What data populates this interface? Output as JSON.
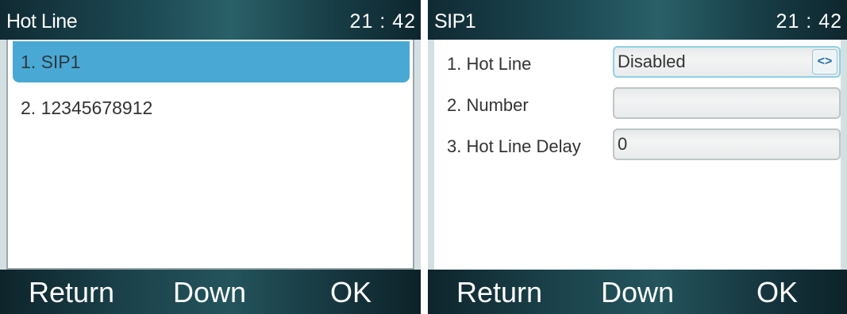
{
  "left_screen": {
    "title": "Hot Line",
    "clock": "21 : 42",
    "items": [
      {
        "label": "1. SIP1",
        "selected": true
      },
      {
        "label": "2. 12345678912",
        "selected": false
      }
    ],
    "softkeys": {
      "left": "Return",
      "middle": "Down",
      "right": "OK"
    }
  },
  "right_screen": {
    "title": "SIP1",
    "clock": "21 : 42",
    "rows": [
      {
        "label": "1.  Hot Line",
        "value": "Disabled",
        "selector_icon": "<>"
      },
      {
        "label": "2.  Number",
        "value": ""
      },
      {
        "label": "3.  Hot Line Delay",
        "value": "0"
      }
    ],
    "softkeys": {
      "left": "Return",
      "middle": "Down",
      "right": "OK"
    }
  },
  "colors": {
    "selection_highlight": "#4aa8d4",
    "title_bar": "#1d4a54",
    "soft_bar": "#1b424b",
    "selector_arrow": "#2a6fa3"
  }
}
